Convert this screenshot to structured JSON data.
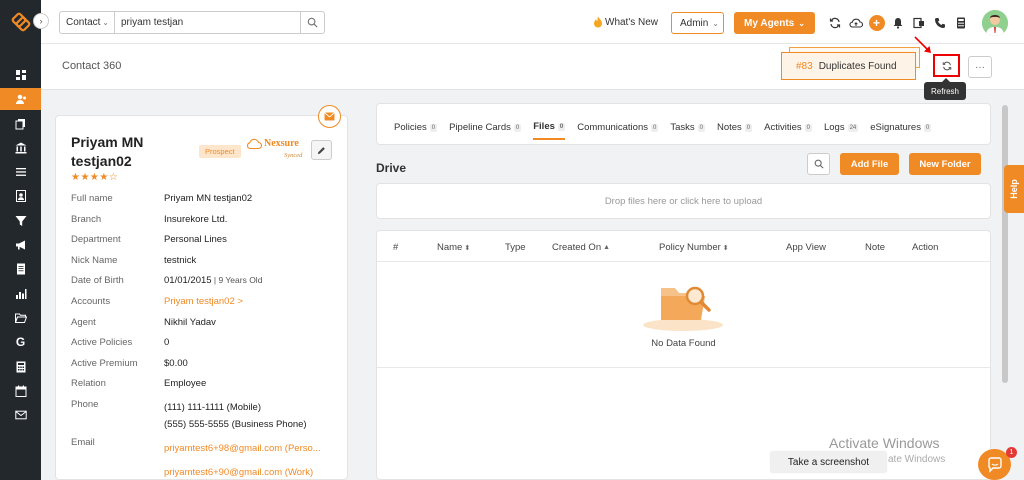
{
  "topbar": {
    "search_type": "Contact",
    "search_value": "priyam testjan",
    "whats_new": "What's New",
    "admin_label": "Admin",
    "my_agents_label": "My Agents"
  },
  "subheader": {
    "title": "Contact 360",
    "duplicates_number": "#83",
    "duplicates_text": "Duplicates Found",
    "tooltip": "Refresh"
  },
  "contact": {
    "name": "Priyam MN testjan02",
    "stars": "★★★★☆",
    "badge": "Prospect",
    "integration_brand": "Nexsure",
    "integration_status": "Synced",
    "fields": [
      {
        "label": "Full name",
        "value": "Priyam MN testjan02"
      },
      {
        "label": "Branch",
        "value": "Insurekore Ltd."
      },
      {
        "label": "Department",
        "value": "Personal Lines"
      },
      {
        "label": "Nick Name",
        "value": "testnick"
      },
      {
        "label": "Date of Birth",
        "value": "01/01/2015",
        "extra": " | 9 Years Old"
      },
      {
        "label": "Accounts",
        "value": "Priyam testjan02 >"
      },
      {
        "label": "Agent",
        "value": "Nikhil Yadav"
      },
      {
        "label": "Active Policies",
        "value": "0"
      },
      {
        "label": "Active Premium",
        "value": "$0.00"
      },
      {
        "label": "Relation",
        "value": "Employee"
      },
      {
        "label": "Phone",
        "value": "(111) 111-1111 (Mobile)",
        "value2": "(555) 555-5555 (Business Phone)"
      },
      {
        "label": "Email",
        "value": "priyamtest6+98@gmail.com  (Perso...",
        "value2": "priyamtest6+90@gmail.com  (Work)"
      }
    ]
  },
  "tabs": [
    {
      "label": "Policies",
      "count": "0"
    },
    {
      "label": "Pipeline Cards",
      "count": "0"
    },
    {
      "label": "Files",
      "count": "0"
    },
    {
      "label": "Communications",
      "count": "0"
    },
    {
      "label": "Tasks",
      "count": "0"
    },
    {
      "label": "Notes",
      "count": "0"
    },
    {
      "label": "Activities",
      "count": "0"
    },
    {
      "label": "Logs",
      "count": "24"
    },
    {
      "label": "eSignatures",
      "count": "0"
    }
  ],
  "drive": {
    "title": "Drive",
    "add_file": "Add File",
    "new_folder": "New Folder",
    "dropzone_text": "Drop files here or click here to upload",
    "columns": [
      "#",
      "Name",
      "Type",
      "Created On",
      "Policy Number",
      "App View",
      "Note",
      "Action"
    ],
    "empty_text": "No Data Found"
  },
  "misc": {
    "help": "Help",
    "activate_title": "Activate Windows",
    "activate_sub": "ate Windows",
    "screenshot_label": "Take a screenshot",
    "chat_badge": "1"
  },
  "colors": {
    "accent": "#f08a24",
    "sidebar": "#23282d"
  }
}
